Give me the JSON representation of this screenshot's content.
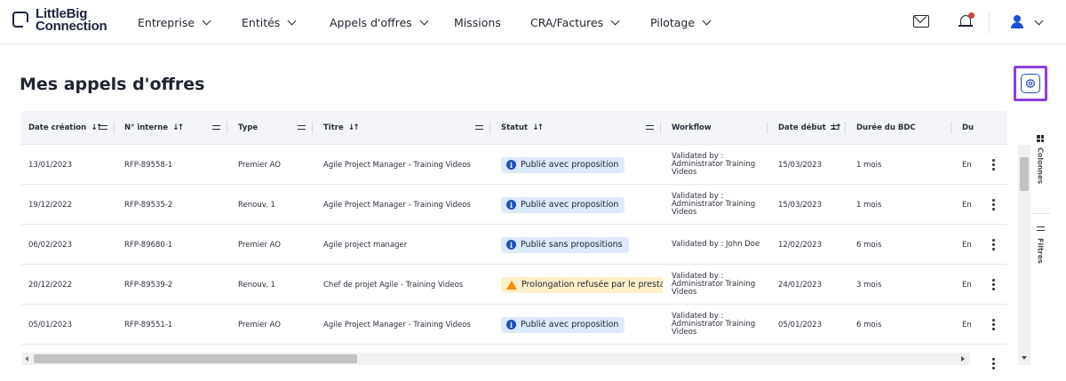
{
  "brand": {
    "line1": "LittleBig",
    "line2": "Connection"
  },
  "nav": [
    {
      "label": "Entreprise",
      "has_menu": true
    },
    {
      "label": "Entités",
      "has_menu": true
    },
    {
      "label": "Appels d'offres",
      "has_menu": true
    },
    {
      "label": "Missions",
      "has_menu": false
    },
    {
      "label": "CRA/Factures",
      "has_menu": true
    },
    {
      "label": "Pilotage",
      "has_menu": true
    }
  ],
  "page": {
    "title": "Mes appels d'offres"
  },
  "columns": [
    "Date création",
    "N° interne",
    "Type",
    "Titre",
    "Statut",
    "Workflow",
    "Date début",
    "Durée du BDC",
    "Du"
  ],
  "rows": [
    {
      "date": "13/01/2023",
      "ref": "RFP-89558-1",
      "type": "Premier AO",
      "title": "Agile Project Manager - Training Videos",
      "status": "Publié avec proposition",
      "status_kind": "info",
      "workflow": "Validated by : Administrator Training Videos",
      "start": "15/03/2023",
      "duration": "1 mois",
      "du": "En"
    },
    {
      "date": "19/12/2022",
      "ref": "RFP-89535-2",
      "type": "Renouv. 1",
      "title": "Agile Project Manager - Training Videos",
      "status": "Publié avec proposition",
      "status_kind": "info",
      "workflow": "Validated by : Administrator Training Videos",
      "start": "15/03/2023",
      "duration": "1 mois",
      "du": "En"
    },
    {
      "date": "06/02/2023",
      "ref": "RFP-89680-1",
      "type": "Premier AO",
      "title": "Agile project manager",
      "status": "Publié sans propositions",
      "status_kind": "info",
      "workflow": "Validated by : John Doe",
      "start": "12/02/2023",
      "duration": "6 mois",
      "du": "En"
    },
    {
      "date": "20/12/2022",
      "ref": "RFP-89539-2",
      "type": "Renouv. 1",
      "title": "Chef de projet Agile - Training Videos",
      "status": "Prolongation refusée par le prestat",
      "status_kind": "warn",
      "workflow": "Validated by : Administrator Training Videos",
      "start": "24/01/2023",
      "duration": "3 mois",
      "du": "En"
    },
    {
      "date": "05/01/2023",
      "ref": "RFP-89551-1",
      "type": "Premier AO",
      "title": "Agile Project Manager - Training Videos",
      "status": "Publié avec proposition",
      "status_kind": "info",
      "workflow": "Validated by : Administrator Training Videos",
      "start": "05/01/2023",
      "duration": "6 mois",
      "du": "En"
    }
  ],
  "side_panel": {
    "columns_label": "Colonnes",
    "filters_label": "Filtres"
  },
  "colors": {
    "accent": "#1d4fd8",
    "highlight": "#8b3fe0",
    "info_badge": "#dce9fb",
    "warn_badge": "#fdf0c9",
    "notification": "#e5383b"
  },
  "icons": [
    "mail-icon",
    "bell-icon",
    "user-icon",
    "settings-icon",
    "sort-icon",
    "filter-icon",
    "more-vertical-icon",
    "info-icon",
    "warning-icon",
    "columns-icon",
    "filters-icon"
  ]
}
